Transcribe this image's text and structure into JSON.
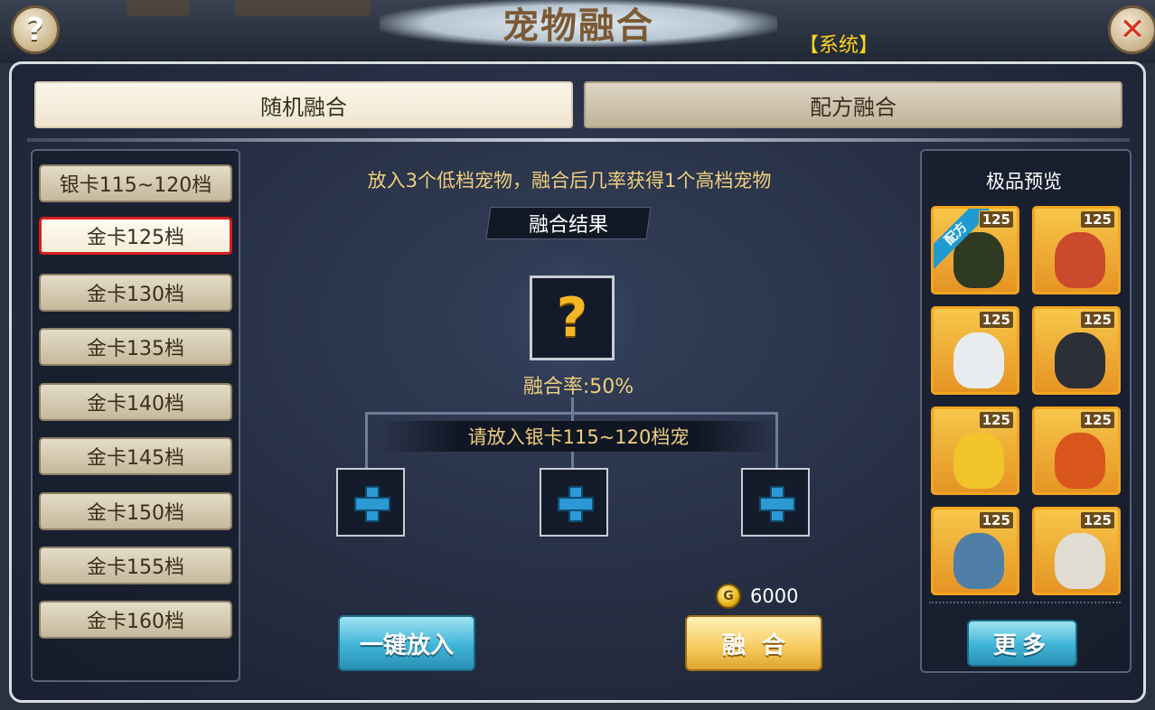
{
  "header": {
    "title": "宠物融合",
    "system_tag": "【系统】",
    "help_glyph": "?",
    "close_glyph": "✕"
  },
  "tabs": [
    {
      "label": "随机融合",
      "active": true
    },
    {
      "label": "配方融合",
      "active": false
    }
  ],
  "tiers": [
    {
      "label": "银卡115~120档",
      "selected": false
    },
    {
      "label": "金卡125档",
      "selected": true
    },
    {
      "label": "金卡130档",
      "selected": false
    },
    {
      "label": "金卡135档",
      "selected": false
    },
    {
      "label": "金卡140档",
      "selected": false
    },
    {
      "label": "金卡145档",
      "selected": false
    },
    {
      "label": "金卡150档",
      "selected": false
    },
    {
      "label": "金卡155档",
      "selected": false
    },
    {
      "label": "金卡160档",
      "selected": false
    }
  ],
  "fusion": {
    "description": "放入3个低档宠物，融合后几率获得1个高档宠物",
    "result_label": "融合结果",
    "result_placeholder": "?",
    "rate": "融合率:50%",
    "put_hint": "请放入银卡115~120档宠",
    "cost": "6000",
    "auto_fill_button": "一键放入",
    "fuse_button": "融合"
  },
  "preview": {
    "title": "极品预览",
    "recipe_ribbon": "配方",
    "more_button": "更多",
    "pets": [
      {
        "level": "125",
        "icon": "pet-dark-warrior-icon",
        "color": "#2f3a23",
        "recipe": true
      },
      {
        "level": "125",
        "icon": "pet-red-fox-girl-icon",
        "color": "#c94a2c",
        "recipe": false
      },
      {
        "level": "125",
        "icon": "pet-white-fox-icon",
        "color": "#e9ecef",
        "recipe": false
      },
      {
        "level": "125",
        "icon": "pet-black-beast-icon",
        "color": "#2d2f36",
        "recipe": false
      },
      {
        "level": "125",
        "icon": "pet-yellow-sprite-icon",
        "color": "#f1c42a",
        "recipe": false
      },
      {
        "level": "125",
        "icon": "pet-fire-demon-icon",
        "color": "#d8561c",
        "recipe": false
      },
      {
        "level": "125",
        "icon": "pet-blue-skeleton-icon",
        "color": "#4f7fa6",
        "recipe": false
      },
      {
        "level": "125",
        "icon": "pet-bone-beast-icon",
        "color": "#e1ddd2",
        "recipe": false
      }
    ]
  }
}
